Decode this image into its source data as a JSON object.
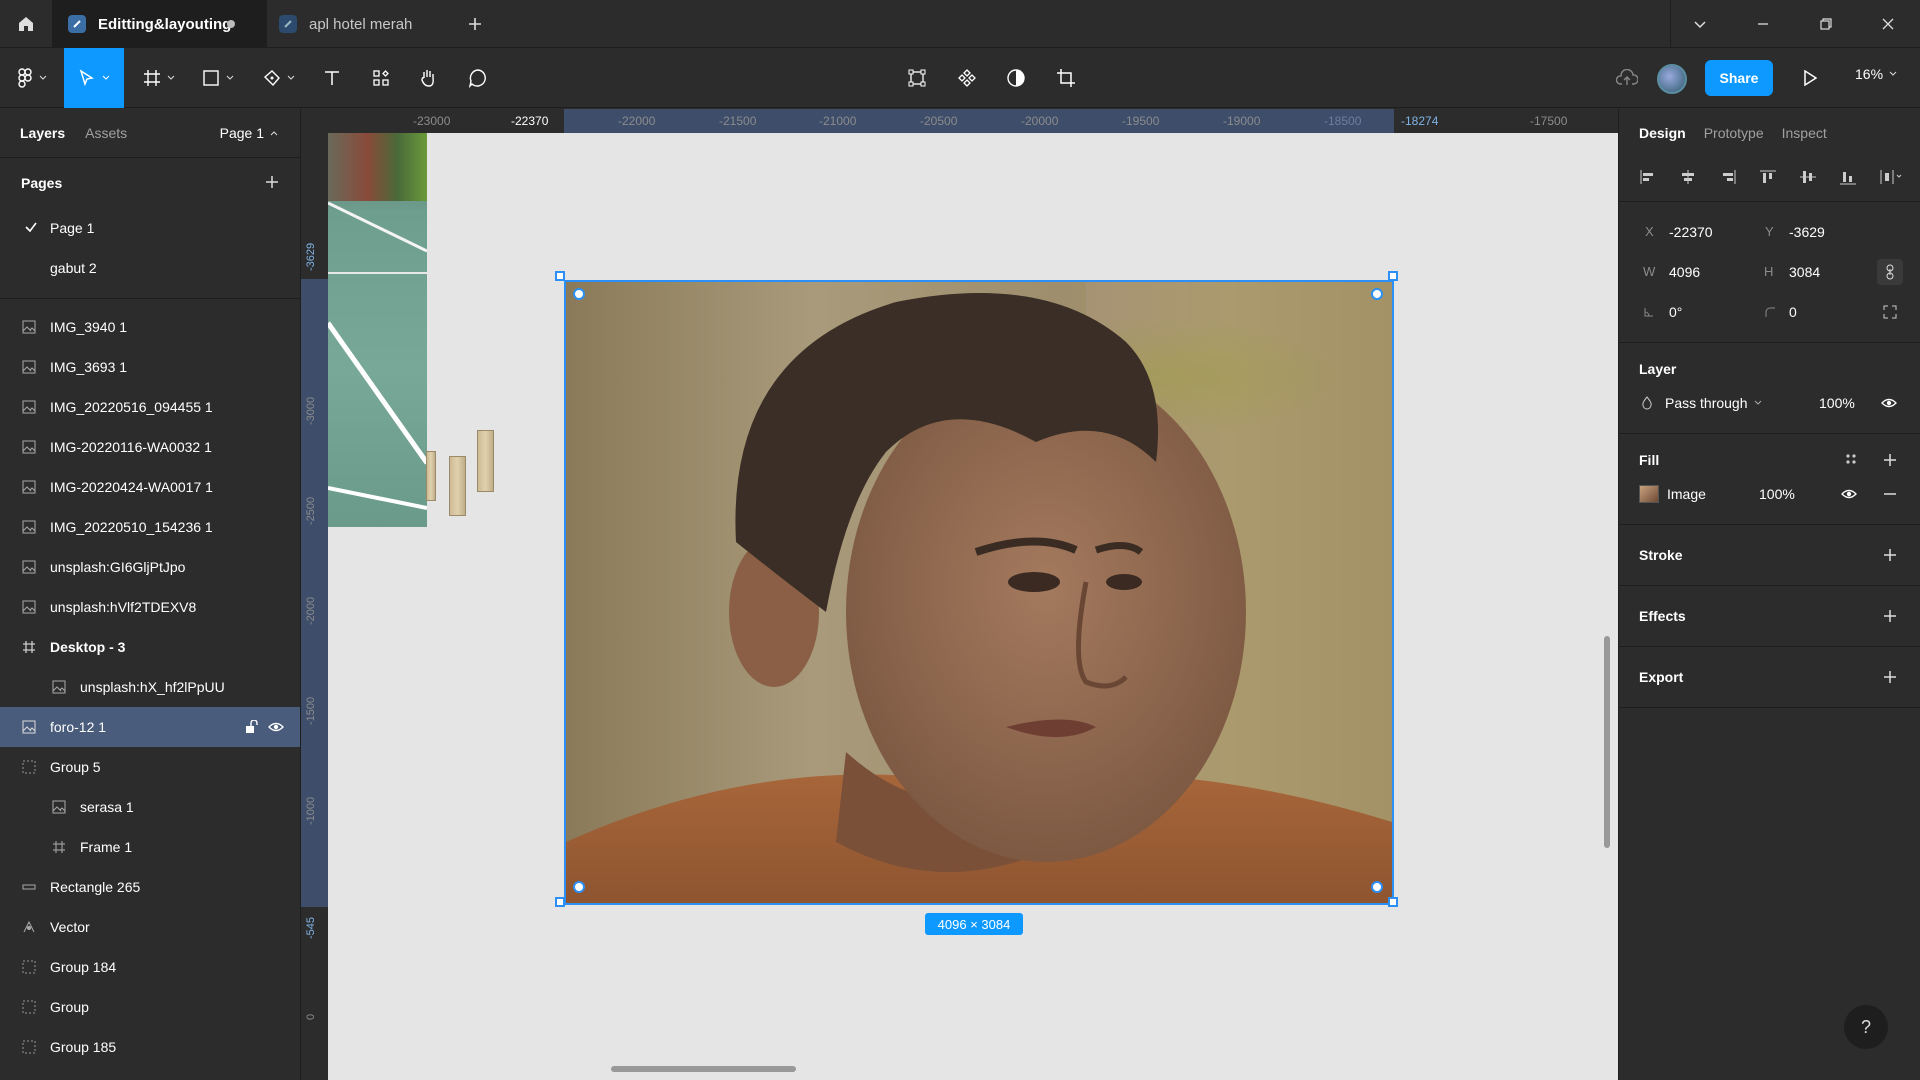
{
  "titlebar": {
    "tabs": [
      {
        "label": "Editting&layouting",
        "active": true,
        "unsaved": true
      },
      {
        "label": "apl hotel merah",
        "active": false
      }
    ]
  },
  "toolbar": {
    "share_label": "Share",
    "zoom_label": "16%"
  },
  "left_panel": {
    "tab_layers": "Layers",
    "tab_assets": "Assets",
    "page_selector": "Page 1",
    "pages_heading": "Pages",
    "pages": [
      {
        "label": "Page 1",
        "current": true
      },
      {
        "label": "gabut 2",
        "current": false
      }
    ],
    "layers": [
      {
        "label": "IMG_3940 1",
        "icon": "image-icon"
      },
      {
        "label": "IMG_3693 1",
        "icon": "image-icon"
      },
      {
        "label": "IMG_20220516_094455 1",
        "icon": "image-icon"
      },
      {
        "label": "IMG-20220116-WA0032 1",
        "icon": "image-icon"
      },
      {
        "label": "IMG-20220424-WA0017 1",
        "icon": "image-icon"
      },
      {
        "label": "IMG_20220510_154236 1",
        "icon": "image-icon"
      },
      {
        "label": "unsplash:GI6GljPtJpo",
        "icon": "image-icon"
      },
      {
        "label": "unsplash:hVlf2TDEXV8",
        "icon": "image-icon"
      },
      {
        "label": "Desktop - 3",
        "icon": "frame-icon"
      },
      {
        "label": "unsplash:hX_hf2lPpUU",
        "icon": "image-icon"
      },
      {
        "label": "foro-12 1",
        "icon": "image-icon"
      },
      {
        "label": "Group 5",
        "icon": "group-icon"
      },
      {
        "label": "serasa 1",
        "icon": "image-icon"
      },
      {
        "label": "Frame 1",
        "icon": "frame-icon"
      },
      {
        "label": "Rectangle 265",
        "icon": "rectangle-icon"
      },
      {
        "label": "Vector",
        "icon": "vector-icon"
      },
      {
        "label": "Group 184",
        "icon": "group-icon"
      },
      {
        "label": "Group",
        "icon": "group-icon"
      },
      {
        "label": "Group 185",
        "icon": "group-icon"
      }
    ]
  },
  "ruler": {
    "top_ticks": [
      "-23000",
      "-22370",
      "-22000",
      "-21500",
      "-21000",
      "-20500",
      "-20000",
      "-19500",
      "-19000",
      "-18500",
      "-18274",
      "-17500"
    ],
    "left_ticks": [
      "-3629",
      "-3000",
      "-2500",
      "-2000",
      "-1500",
      "-1000",
      "-545",
      "0"
    ]
  },
  "canvas": {
    "size_badge": "4096 × 3084"
  },
  "right_panel": {
    "tabs": [
      "Design",
      "Prototype",
      "Inspect"
    ],
    "x_label": "X",
    "x_value": "-22370",
    "y_label": "Y",
    "y_value": "-3629",
    "w_label": "W",
    "w_value": "4096",
    "h_label": "H",
    "h_value": "3084",
    "rotation_value": "0°",
    "radius_value": "0",
    "layer_heading": "Layer",
    "blend_mode": "Pass through",
    "layer_opacity": "100%",
    "fill_heading": "Fill",
    "fill_type": "Image",
    "fill_opacity": "100%",
    "stroke_heading": "Stroke",
    "effects_heading": "Effects",
    "export_heading": "Export"
  },
  "help_label": "?"
}
